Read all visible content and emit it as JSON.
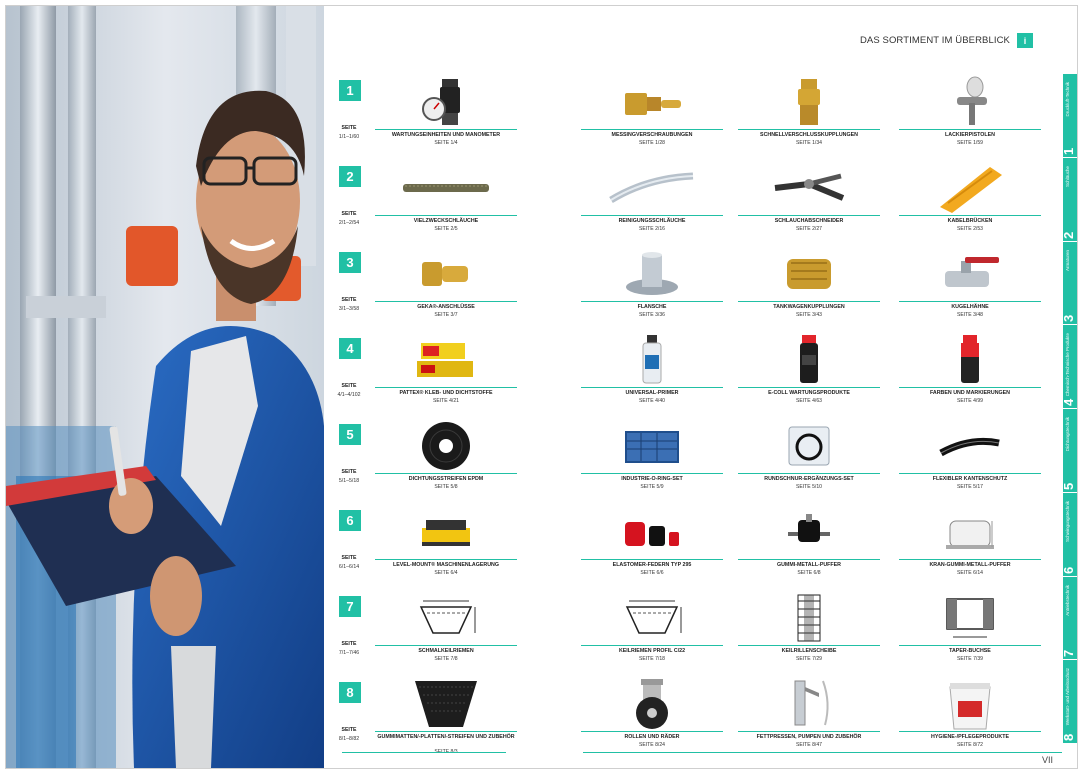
{
  "header": {
    "title": "DAS SORTIMENT IM ÜBERBLICK",
    "info_icon": "i"
  },
  "colors": {
    "accent": "#21c0a5"
  },
  "tabs": [
    {
      "num": "1",
      "title": "Druckluft-Technik"
    },
    {
      "num": "2",
      "title": "Schläuche"
    },
    {
      "num": "3",
      "title": "Armaturen"
    },
    {
      "num": "4",
      "title": "Chemisch-Technische Produkte"
    },
    {
      "num": "5",
      "title": "Dichtungstechnik"
    },
    {
      "num": "6",
      "title": "Schwingungstechnik"
    },
    {
      "num": "7",
      "title": "Antriebstechnik"
    },
    {
      "num": "8",
      "title": "Werkstatt- und Arbeitsschutz"
    }
  ],
  "sections": [
    {
      "num": "1",
      "label": "SEITE",
      "pages": "1/1–1/60",
      "items": [
        {
          "name": "WARTUNGSEINHEITEN UND MANOMETER",
          "page": "SEITE 1/4",
          "icon": "pressure-regulator"
        },
        {
          "name": "MESSINGVERSCHRAUBUNGEN",
          "page": "SEITE 1/28",
          "icon": "brass-fitting"
        },
        {
          "name": "SCHNELLVERSCHLUSSKUPPLUNGEN",
          "page": "SEITE 1/34",
          "icon": "quick-coupling"
        },
        {
          "name": "LACKIERPISTOLEN",
          "page": "SEITE 1/59",
          "icon": "spray-gun"
        }
      ]
    },
    {
      "num": "2",
      "label": "SEITE",
      "pages": "2/1–2/54",
      "items": [
        {
          "name": "VIELZWECKSCHLÄUCHE",
          "page": "SEITE 2/5",
          "icon": "hose"
        },
        {
          "name": "REINIGUNGSSCHLÄUCHE",
          "page": "SEITE 2/16",
          "icon": "cleaning-hose"
        },
        {
          "name": "SCHLAUCHABSCHNEIDER",
          "page": "SEITE 2/27",
          "icon": "hose-cutter"
        },
        {
          "name": "KABELBRÜCKEN",
          "page": "SEITE 2/53",
          "icon": "cable-bridge"
        }
      ]
    },
    {
      "num": "3",
      "label": "SEITE",
      "pages": "3/1–3/58",
      "items": [
        {
          "name": "GEKA®-ANSCHLÜSSE",
          "page": "SEITE 3/7",
          "icon": "geka-connector"
        },
        {
          "name": "FLANSCHE",
          "page": "SEITE 3/36",
          "icon": "flange"
        },
        {
          "name": "TANKWAGENKUPPLUNGEN",
          "page": "SEITE 3/43",
          "icon": "tank-coupling"
        },
        {
          "name": "KUGELHÄHNE",
          "page": "SEITE 3/48",
          "icon": "ball-valve"
        }
      ]
    },
    {
      "num": "4",
      "label": "SEITE",
      "pages": "4/1–4/102",
      "items": [
        {
          "name": "PATTEX® KLEB- UND DICHTSTOFFE",
          "page": "SEITE 4/21",
          "icon": "adhesive"
        },
        {
          "name": "UNIVERSAL-PRIMER",
          "page": "SEITE 4/40",
          "icon": "primer-bottle"
        },
        {
          "name": "E-COLL WARTUNGSPRODUKTE",
          "page": "SEITE 4/63",
          "icon": "spray-can-black"
        },
        {
          "name": "FARBEN UND MARKIERUNGEN",
          "page": "SEITE 4/99",
          "icon": "spray-can-red"
        }
      ]
    },
    {
      "num": "5",
      "label": "SEITE",
      "pages": "5/1–5/18",
      "items": [
        {
          "name": "DICHTUNGSSTREIFEN EPDM",
          "page": "SEITE 5/8",
          "icon": "seal-roll"
        },
        {
          "name": "INDUSTRIE-O-RING-SET",
          "page": "SEITE 5/9",
          "icon": "oring-box"
        },
        {
          "name": "RUNDSCHNUR-ERGÄNZUNGS-SET",
          "page": "SEITE 5/10",
          "icon": "cord-set"
        },
        {
          "name": "FLEXIBLER KANTENSCHUTZ",
          "page": "SEITE 5/17",
          "icon": "edge-protection"
        }
      ]
    },
    {
      "num": "6",
      "label": "SEITE",
      "pages": "6/1–6/14",
      "items": [
        {
          "name": "LEVEL-MOUNT® MASCHINENLAGERUNG",
          "page": "SEITE 6/4",
          "icon": "machine-mount"
        },
        {
          "name": "ELASTOMER-FEDERN TYP 295",
          "page": "SEITE 6/6",
          "icon": "elastomer-spring"
        },
        {
          "name": "GUMMI-METALL-PUFFER",
          "page": "SEITE 6/8",
          "icon": "rubber-buffer"
        },
        {
          "name": "KRAN-GUMMI-METALL-PUFFER",
          "page": "SEITE 6/14",
          "icon": "crane-buffer"
        }
      ]
    },
    {
      "num": "7",
      "label": "SEITE",
      "pages": "7/1–7/46",
      "items": [
        {
          "name": "SCHMALKEILRIEMEN",
          "page": "SEITE 7/8",
          "icon": "v-belt"
        },
        {
          "name": "KEILRIEMEN PROFIL C/22",
          "page": "SEITE 7/18",
          "icon": "v-belt-c22"
        },
        {
          "name": "KEILRILLENSCHEIBE",
          "page": "SEITE 7/29",
          "icon": "pulley"
        },
        {
          "name": "TAPER-BUCHSE",
          "page": "SEITE 7/39",
          "icon": "taper-bush"
        }
      ]
    },
    {
      "num": "8",
      "label": "SEITE",
      "pages": "8/1–8/82",
      "items": [
        {
          "name": "GUMMIMATTEN/-PLATTEN/-STREIFEN UND ZUBEHÖR",
          "page": "SEITE 8/3",
          "icon": "rubber-mat"
        },
        {
          "name": "ROLLEN UND RÄDER",
          "page": "SEITE 8/24",
          "icon": "caster-wheel"
        },
        {
          "name": "FETTPRESSEN, PUMPEN UND ZUBEHÖR",
          "page": "SEITE 8/47",
          "icon": "grease-gun"
        },
        {
          "name": "HYGIENE-/PFLEGEPRODUKTE",
          "page": "SEITE 8/72",
          "icon": "cleaning-bucket"
        }
      ]
    }
  ],
  "page_number": "VII"
}
